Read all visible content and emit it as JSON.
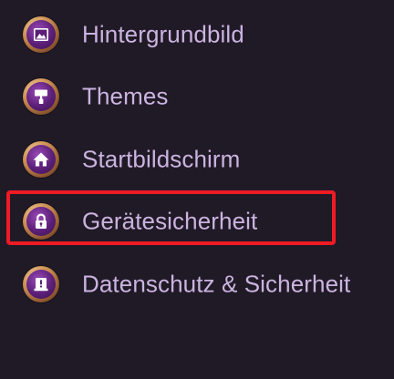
{
  "menu": {
    "items": [
      {
        "label": "Hintergrundbild",
        "icon": "image-icon"
      },
      {
        "label": "Themes",
        "icon": "paint-roller-icon"
      },
      {
        "label": "Startbildschirm",
        "icon": "home-icon"
      },
      {
        "label": "Gerätesicherheit",
        "icon": "lock-icon"
      },
      {
        "label": "Datenschutz & Sicherheit",
        "icon": "shield-alert-icon"
      }
    ],
    "highlighted_item": "Gerätesicherheit"
  },
  "colors": {
    "background": "#201a27",
    "label_text": "#cbb3df",
    "highlight_border": "#ee1b24",
    "icon_inner": "#5b1f78",
    "icon_ring": "#c7894f"
  }
}
